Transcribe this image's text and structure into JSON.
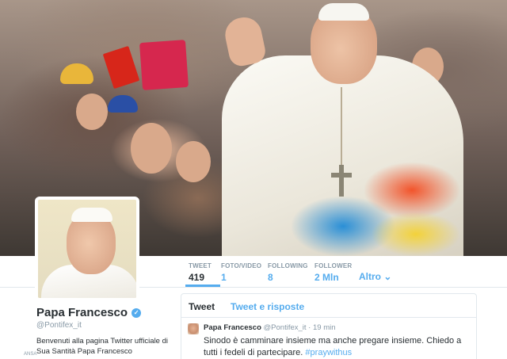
{
  "profile": {
    "name": "Papa Francesco",
    "handle": "@Pontifex_it",
    "bio": "Benvenuti alla pagina Twitter ufficiale di Sua Santità Papa Francesco",
    "verified_glyph": "✓",
    "footer_mark": "ANSA"
  },
  "stats": [
    {
      "label": "TWEET",
      "value": "419"
    },
    {
      "label": "FOTO/VIDEO",
      "value": "1"
    },
    {
      "label": "FOLLOWING",
      "value": "8"
    },
    {
      "label": "FOLLOWER",
      "value": "2 Mln"
    }
  ],
  "more": {
    "label": "Altro",
    "icon": "chevron-down-icon",
    "glyph": "⌄"
  },
  "timeline": {
    "tabs": [
      "Tweet",
      "Tweet e risposte"
    ],
    "tweet": {
      "author": "Papa Francesco",
      "handle": "@Pontifex_it",
      "separator": "·",
      "time": "19 min",
      "text": "Sinodo è camminare insieme ma anche pregare insieme. Chiedo a tutti i fedeli di partecipare.",
      "hashtag": "#praywithus"
    }
  },
  "colors": {
    "accent": "#55acee",
    "text": "#292f33",
    "muted": "#8899a6"
  }
}
